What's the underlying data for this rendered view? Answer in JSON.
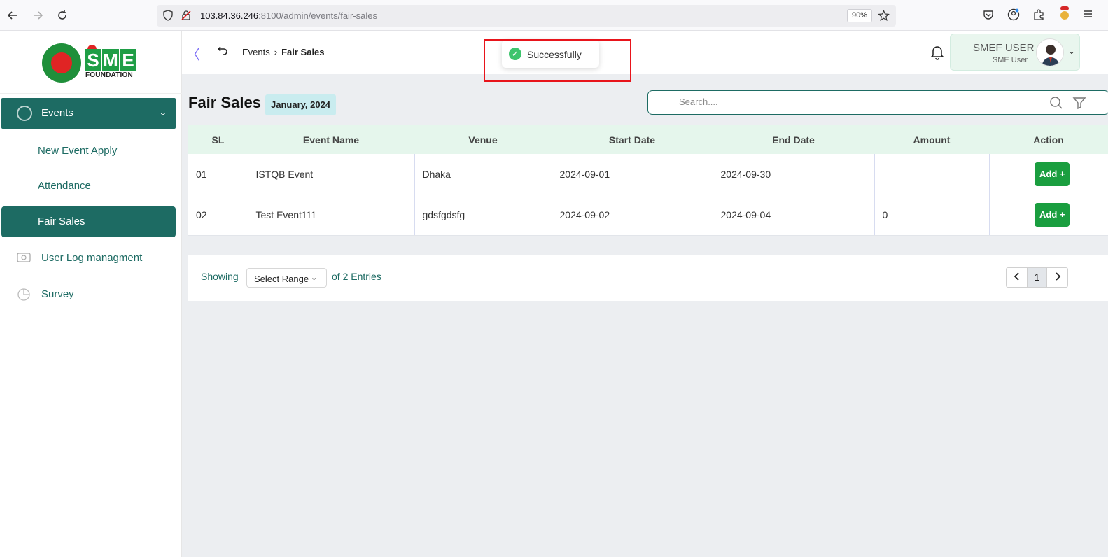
{
  "browser": {
    "url_host": "103.84.36.246",
    "url_path": ":8100/admin/events/fair-sales",
    "zoom": "90%"
  },
  "brand": {
    "logo_letters": [
      "S",
      "M",
      "E"
    ],
    "logo_subtitle": "FOUNDATION"
  },
  "sidebar": {
    "events_label": "Events",
    "sub_items": [
      "New Event Apply",
      "Attendance",
      "Fair Sales"
    ],
    "other_items": [
      "User Log managment",
      "Survey"
    ]
  },
  "topbar": {
    "breadcrumb_parent": "Events",
    "breadcrumb_current": "Fair Sales",
    "user_name": "SMEF USER",
    "user_role": "SME User"
  },
  "toast": {
    "message": "Successfully"
  },
  "page": {
    "title": "Fair Sales",
    "date_badge": "January, 2024",
    "search_placeholder": "Search...."
  },
  "table": {
    "columns": [
      "SL",
      "Event Name",
      "Venue",
      "Start Date",
      "End Date",
      "Amount",
      "Action"
    ],
    "rows": [
      {
        "sl": "01",
        "event_name": "ISTQB Event",
        "venue": "Dhaka",
        "start_date": "2024-09-01",
        "end_date": "2024-09-30",
        "amount": "",
        "action": "Add +"
      },
      {
        "sl": "02",
        "event_name": "Test Event111",
        "venue": "gdsfgdsfg",
        "start_date": "2024-09-02",
        "end_date": "2024-09-04",
        "amount": "0",
        "action": "Add +"
      }
    ]
  },
  "pagination": {
    "showing_label": "Showing",
    "range_select": "Select Range",
    "entries_label": "of 2 Entries",
    "current_page": "1"
  },
  "colors": {
    "brand_teal": "#1d6b63",
    "action_green": "#1a9e3f",
    "highlight_red": "#e8141b"
  }
}
